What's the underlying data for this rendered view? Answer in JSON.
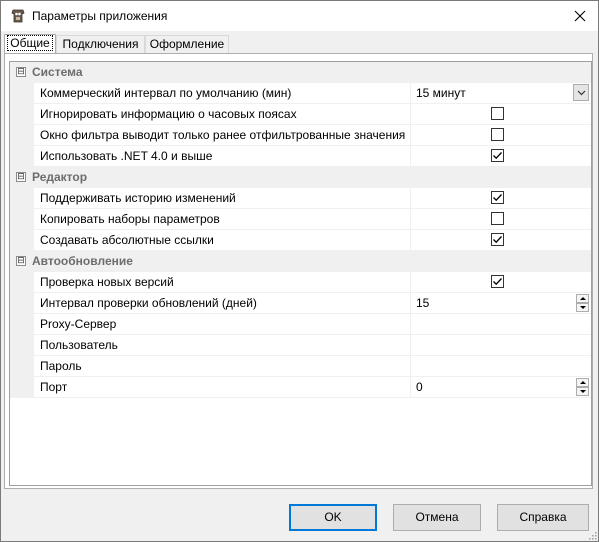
{
  "window": {
    "title": "Параметры приложения"
  },
  "tabs": [
    {
      "label": "Общие",
      "active": true
    },
    {
      "label": "Подключения",
      "active": false
    },
    {
      "label": "Оформление",
      "active": false
    }
  ],
  "categories": [
    {
      "title": "Система",
      "expander": "⊟",
      "rows": [
        {
          "name": "Коммерческий интервал по умолчанию (мин)",
          "type": "dropdown",
          "value": "15 минут"
        },
        {
          "name": "Игнорировать информацию о часовых поясах",
          "type": "checkbox",
          "checked": false
        },
        {
          "name": "Окно фильтра выводит только ранее отфильтрованные значения",
          "type": "checkbox",
          "checked": false
        },
        {
          "name": "Использовать .NET 4.0 и выше",
          "type": "checkbox",
          "checked": true
        }
      ]
    },
    {
      "title": "Редактор",
      "expander": "⊟",
      "rows": [
        {
          "name": "Поддерживать историю изменений",
          "type": "checkbox",
          "checked": true
        },
        {
          "name": "Копировать наборы параметров",
          "type": "checkbox",
          "checked": false
        },
        {
          "name": "Создавать абсолютные ссылки",
          "type": "checkbox",
          "checked": true
        }
      ]
    },
    {
      "title": "Автообновление",
      "expander": "⊟",
      "rows": [
        {
          "name": "Проверка новых версий",
          "type": "checkbox",
          "checked": true
        },
        {
          "name": "Интервал проверки обновлений (дней)",
          "type": "spinner",
          "value": "15"
        },
        {
          "name": "Proxy-Сервер",
          "type": "text",
          "value": ""
        },
        {
          "name": "Пользователь",
          "type": "text",
          "value": ""
        },
        {
          "name": "Пароль",
          "type": "text",
          "value": ""
        },
        {
          "name": "Порт",
          "type": "spinner",
          "value": "0"
        }
      ]
    }
  ],
  "buttons": {
    "ok": "OK",
    "cancel": "Отмена",
    "help": "Справка"
  },
  "colors": {
    "accent": "#0078d7",
    "category_bg": "#f0f0f0",
    "category_text": "#6d6d6d"
  }
}
